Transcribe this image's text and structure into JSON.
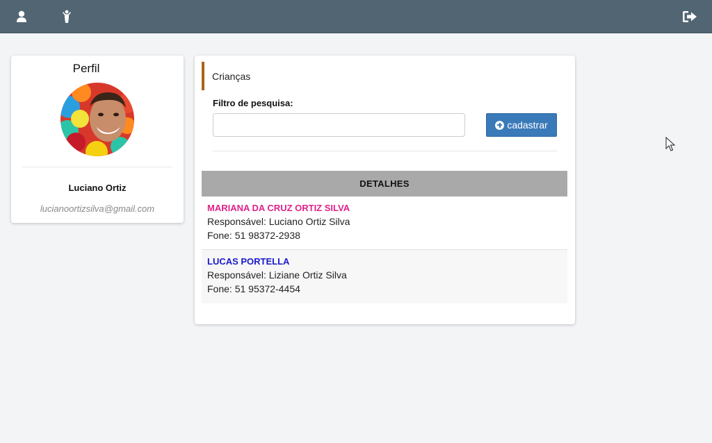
{
  "topbar": {
    "icons": [
      "user-icon",
      "child-icon",
      "logout-icon"
    ],
    "background_color": "#526573"
  },
  "profile": {
    "title": "Perfil",
    "name": "Luciano Ortiz",
    "email": "lucianoortizsilva@gmail.com"
  },
  "children_section": {
    "title": "Crianças",
    "filter_label": "Filtro de pesquisa:",
    "filter_value": "",
    "add_button_label": "cadastrar",
    "accent_color": "#a8651a",
    "button_color": "#3a7ab8"
  },
  "table": {
    "header": "DETALHES",
    "rows": [
      {
        "name": "MARIANA DA CRUZ ORTIZ SILVA",
        "name_color": "#e0218a",
        "responsible": "Responsável: Luciano Ortiz Silva",
        "phone": "Fone: 51 98372-2938"
      },
      {
        "name": "LUCAS PORTELLA",
        "name_color": "#1a1acc",
        "responsible": "Responsável: Liziane Ortiz Silva",
        "phone": "Fone: 51 95372-4454"
      }
    ]
  }
}
